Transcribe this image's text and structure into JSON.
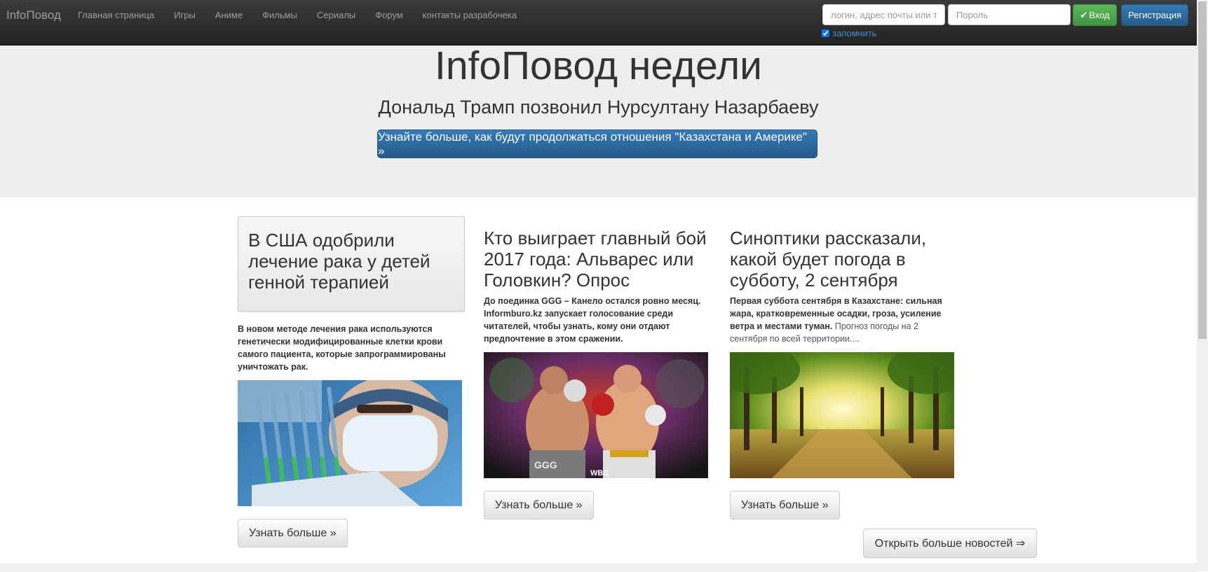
{
  "navbar": {
    "brand": "InfoПовод",
    "links": [
      "Главная страница",
      "Игры",
      "Аниме",
      "Фильмы",
      "Сериалы",
      "Форум",
      "контакты разрабочека"
    ],
    "login_placeholder": "логин, адрес почты или те",
    "password_placeholder": "Пороль",
    "login_button": "Вход",
    "register_button": "Регистрация",
    "remember_label": "запомнить",
    "remember_checked": true
  },
  "jumbotron": {
    "title": "InfoПовод недели",
    "subtitle": "Дональд Трамп позвонил Нурсултану Назарбаеву",
    "button": "Узнайте больше, как будут продолжаться отношения \"Казахстана и Америке\" »"
  },
  "articles": [
    {
      "title": "В США одобрили лечение рака у детей генной терапией",
      "description_bold": "В новом методе лечения рака используются генетически модифицированные клетки крови самого пациента, которые запрограммированы уничтожать рак.",
      "description_extra": "",
      "image": "doctor-test-tubes-image",
      "button": "Узнать больше »"
    },
    {
      "title": "Кто выиграет главный бой 2017 года: Альварес или Головкин? Опрос",
      "description_bold": "До поединка GGG – Канело остался ровно месяц. Informburo.kz запускает голосование среди читателей, чтобы узнать, кому они отдают предпочтение в этом сражении.",
      "description_extra": "",
      "image": "boxing-fight-image",
      "image_labels": [
        "GGG",
        "WBC"
      ],
      "button": "Узнать больше »"
    },
    {
      "title": "Синоптики рассказали, какой будет погода в субботу, 2 сентября",
      "description_bold": "Первая суббота сентября в Казахстане: сильная жара, кратковременные осадки, гроза, усиление ветра и местами туман.",
      "description_extra": "Прогноз погоды на 2 сентября по всей территории....",
      "image": "sunlit-forest-path-image",
      "button": "Узнать больше »"
    }
  ],
  "more_news_button": "Открыть больше новостей ⇒",
  "colors": {
    "navbar_bg": "#222222",
    "jumbotron_bg": "#eeeeee",
    "primary": "#337ab7",
    "success": "#5cb85c",
    "link": "#428bca"
  }
}
